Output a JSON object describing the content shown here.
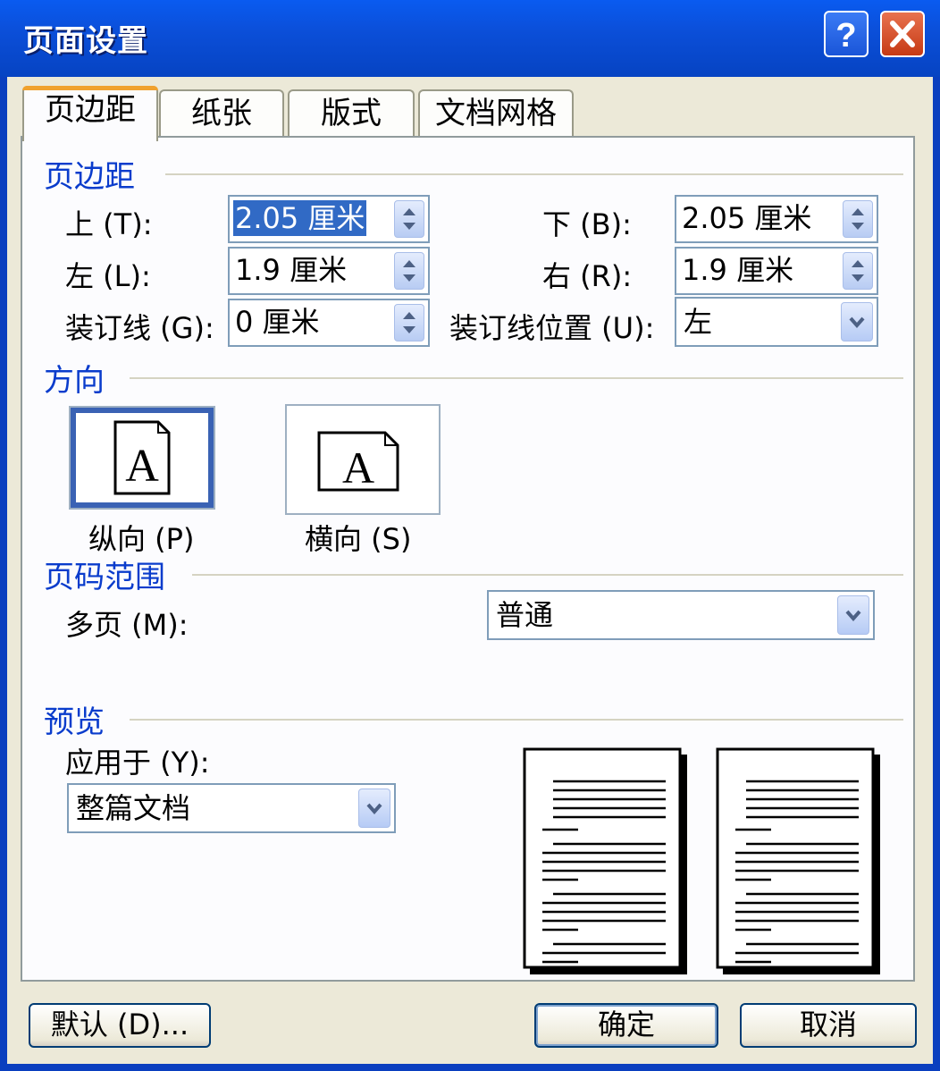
{
  "window": {
    "title": "页面设置"
  },
  "tabs": [
    "页边距",
    "纸张",
    "版式",
    "文档网格"
  ],
  "margins": {
    "group_title": "页边距",
    "top_label": "上 (T):",
    "top_value": "2.05 厘米",
    "bottom_label": "下 (B):",
    "bottom_value": "2.05 厘米",
    "left_label": "左 (L):",
    "left_value": "1.9 厘米",
    "right_label": "右 (R):",
    "right_value": "1.9 厘米",
    "gutter_label": "装订线 (G):",
    "gutter_value": "0 厘米",
    "gutter_pos_label": "装订线位置 (U):",
    "gutter_pos_value": "左"
  },
  "orientation": {
    "group_title": "方向",
    "glyph": "A",
    "portrait_label": "纵向 (P)",
    "landscape_label": "横向 (S)",
    "selected": "portrait"
  },
  "pages": {
    "group_title": "页码范围",
    "multiple_label": "多页 (M):",
    "multiple_value": "普通"
  },
  "preview": {
    "group_title": "预览",
    "apply_label": "应用于 (Y):",
    "apply_value": "整篇文档"
  },
  "buttons": {
    "default": "默认 (D)...",
    "ok": "确定",
    "cancel": "取消"
  },
  "colors": {
    "titlebar": "#0b4fd9",
    "face": "#ece9d8",
    "group_title": "#0a3ccc",
    "selection": "#316ac5"
  },
  "icons": [
    "help-icon",
    "close-icon",
    "spin-arrows-icon",
    "dropdown-arrow-icon",
    "portrait-page-icon",
    "landscape-page-icon",
    "preview-page-icon"
  ]
}
